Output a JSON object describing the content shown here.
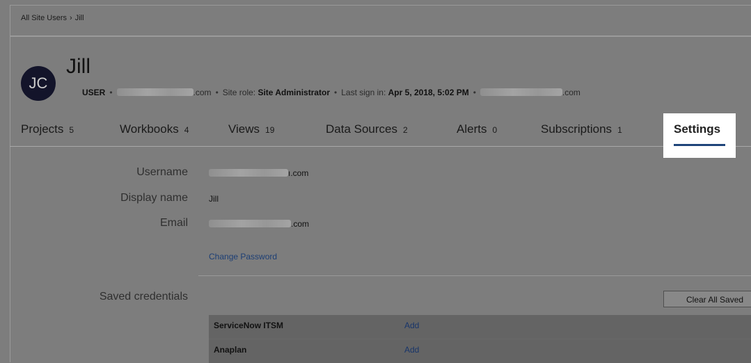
{
  "breadcrumb": {
    "parent": "All Site Users",
    "separator": "›",
    "current": "Jill"
  },
  "user": {
    "initials": "JC",
    "name": "Jill",
    "meta": {
      "type": "USER",
      "email_suffix": ".com",
      "site_role_label": "Site role:",
      "site_role": "Site Administrator",
      "last_signin_label": "Last sign in:",
      "last_signin": "Apr 5, 2018, 5:02 PM",
      "domain_suffix": ".com"
    }
  },
  "tabs": [
    {
      "label": "Projects",
      "count": "5"
    },
    {
      "label": "Workbooks",
      "count": "4"
    },
    {
      "label": "Views",
      "count": "19"
    },
    {
      "label": "Data Sources",
      "count": "2"
    },
    {
      "label": "Alerts",
      "count": "0"
    },
    {
      "label": "Subscriptions",
      "count": "1"
    }
  ],
  "active_tab": {
    "label": "Settings"
  },
  "settings": {
    "username_label": "Username",
    "username_suffix": "ı.com",
    "display_name_label": "Display name",
    "display_name": "Jill",
    "email_label": "Email",
    "email_suffix": ".com",
    "change_password": "Change Password",
    "saved_credentials_label": "Saved credentials",
    "clear_button": "Clear All Saved"
  },
  "credentials": [
    {
      "name": "ServiceNow ITSM",
      "action": "Add"
    },
    {
      "name": "Anaplan",
      "action": "Add"
    }
  ],
  "colors": {
    "avatar_bg": "#13142a",
    "link": "#1d3f75",
    "active_tab_underline": "#1f457a",
    "backdrop": "#7d7d7d"
  }
}
